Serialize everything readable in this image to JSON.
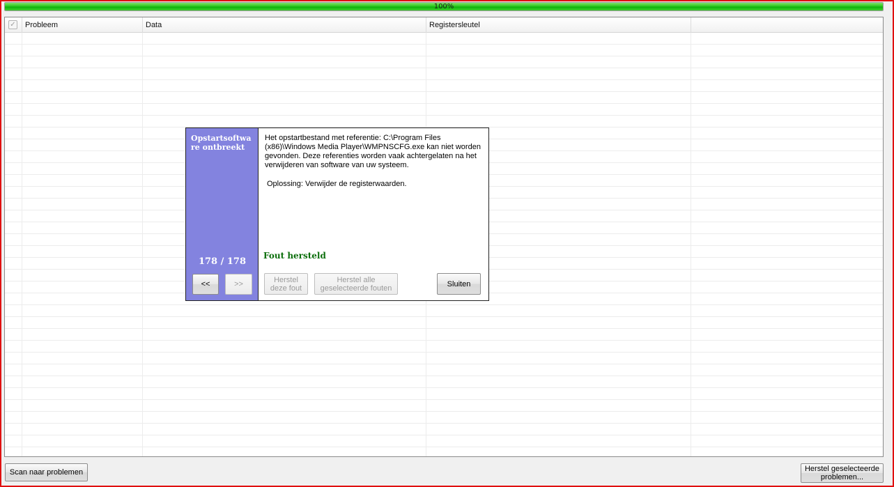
{
  "progress": {
    "value": 100,
    "label": "100%",
    "fill_color": "#22c21a"
  },
  "table": {
    "columns": [
      "Probleem",
      "Data",
      "Registersleutel",
      ""
    ],
    "header_checkbox": "checked"
  },
  "dialog": {
    "title": "Opstartsoftware ontbreekt",
    "counter": "178 / 178",
    "prev_label": "<<",
    "next_label": ">>",
    "message": "Het opstartbestand met referentie: C:\\Program Files (x86)\\Windows Media Player\\WMPNSCFG.exe kan niet worden gevonden. Deze referenties worden vaak achtergelaten na het verwijderen van software van uw systeem.",
    "solution": "Oplossing: Verwijder de registerwaarden.",
    "status": "Fout hersteld",
    "fix_one_label": "Herstel deze fout",
    "fix_all_label": "Herstel alle geselecteerde fouten",
    "close_label": "Sluiten",
    "side_color": "#8383df",
    "status_color": "#0b6e0b"
  },
  "footer": {
    "scan_label": "Scan naar problemen",
    "fix_selected_label": "Herstel geselecteerde problemen..."
  }
}
